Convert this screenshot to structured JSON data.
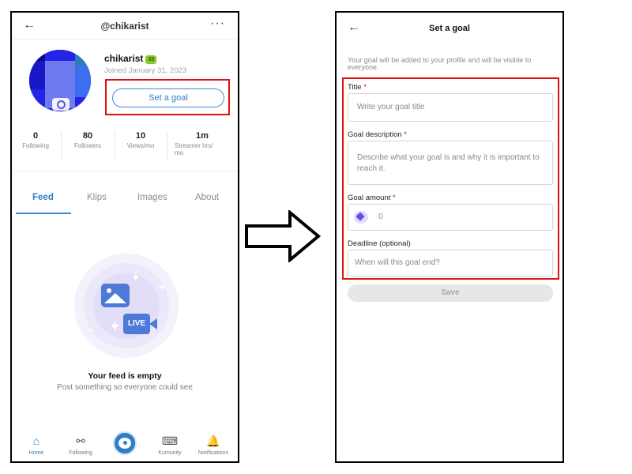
{
  "profile": {
    "handle": "@chikarist",
    "username": "chikarist",
    "level_badge": "33",
    "joined": "Joined January 31, 2023",
    "set_goal_label": "Set a goal",
    "stats": [
      {
        "value": "0",
        "label": "Following"
      },
      {
        "value": "80",
        "label": "Followers"
      },
      {
        "value": "10",
        "label": "Views/mo"
      },
      {
        "value": "1m",
        "label": "Streamer hrs/ mo"
      }
    ],
    "tabs": [
      "Feed",
      "Klips",
      "Images",
      "About"
    ],
    "active_tab": "Feed",
    "live_badge": "LIVE",
    "empty_title": "Your feed is empty",
    "empty_subtitle": "Post something so everyone could see",
    "nav": [
      "Home",
      "Following",
      "Kumunity",
      "Notifications"
    ]
  },
  "goal_form": {
    "title": "Set a goal",
    "notice": "Your goal will be added to your profile and will be visible to everyone.",
    "fields": {
      "title_label": "Title",
      "title_placeholder": "Write your goal title",
      "description_label": "Goal description",
      "description_placeholder": "Describe what your goal is and why it is important to reach it.",
      "amount_label": "Goal amount",
      "amount_value": "0",
      "deadline_label": "Deadline (optional)",
      "deadline_placeholder": "When will this goal end?"
    },
    "required_mark": "*",
    "save_label": "Save"
  },
  "colors": {
    "accent": "#2f7dc9",
    "highlight": "#e01010",
    "required": "#e01010",
    "gem": "#6a4de8"
  },
  "icons": {
    "back": "arrow-left-icon",
    "more": "more-dots-icon",
    "camera": "camera-icon",
    "home": "home-icon",
    "following": "people-icon",
    "kumunity": "chat-icon",
    "notifications": "bell-icon",
    "gem": "gem-icon"
  }
}
